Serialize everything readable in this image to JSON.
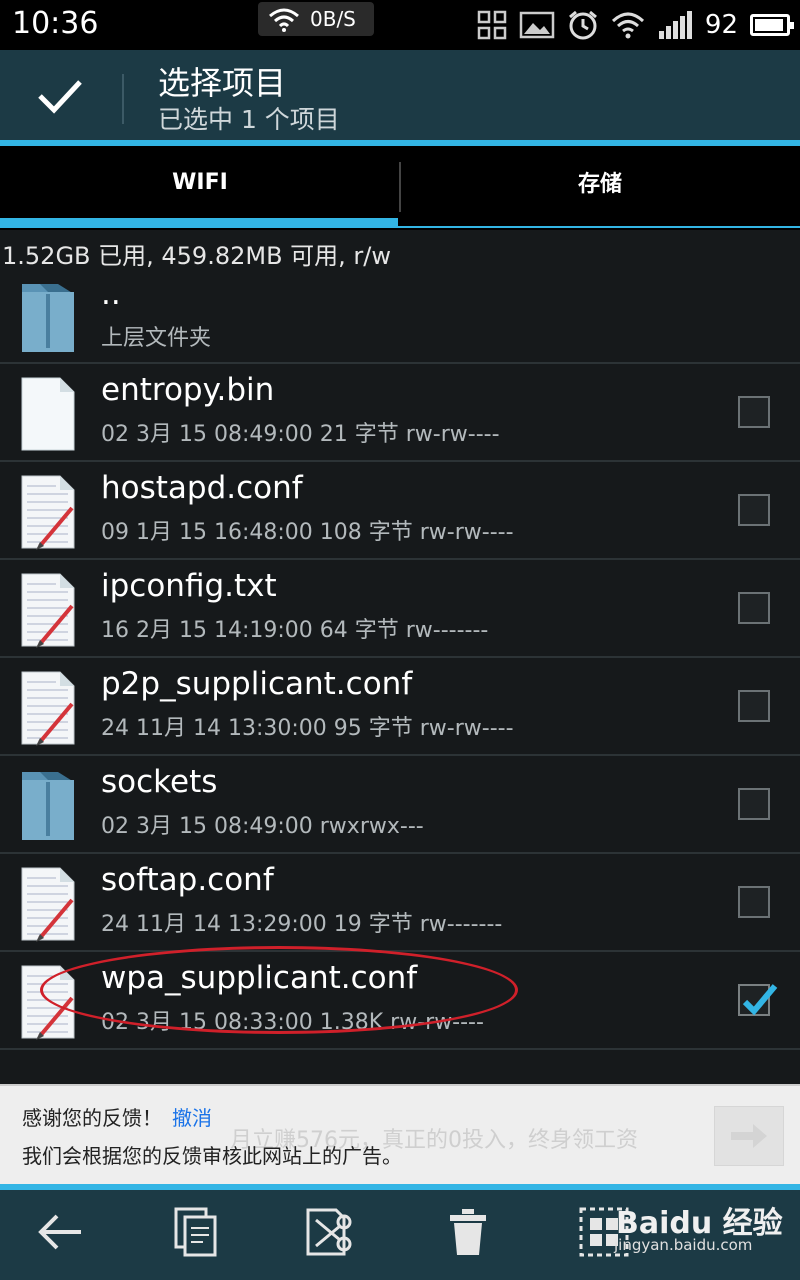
{
  "status_bar": {
    "time": "10:36",
    "net_speed": "0B/S",
    "battery_percent": "92",
    "battery_level": 0.92,
    "icons": [
      "qr-scan-icon",
      "image-icon",
      "alarm-icon",
      "wifi-icon",
      "signal-icon",
      "battery-icon"
    ]
  },
  "action_bar": {
    "title": "选择项目",
    "subtitle": "已选中 1 个项目",
    "confirm_icon": "checkmark-icon"
  },
  "tabs": [
    {
      "label": "WIFI",
      "active": true
    },
    {
      "label": "存储",
      "active": false
    }
  ],
  "storage_info": "1.52GB 已用, 459.82MB 可用, r/w",
  "files": [
    {
      "name": "..",
      "meta": "上层文件夹",
      "type": "folder",
      "checkbox": false
    },
    {
      "name": "entropy.bin",
      "meta": "02 3月 15 08:49:00  21 字节  rw-rw----",
      "type": "blank-file",
      "checkbox": true,
      "checked": false
    },
    {
      "name": "hostapd.conf",
      "meta": "09 1月 15 16:48:00  108 字节  rw-rw----",
      "type": "text-file",
      "checkbox": true,
      "checked": false
    },
    {
      "name": "ipconfig.txt",
      "meta": "16 2月 15 14:19:00  64 字节  rw-------",
      "type": "text-file",
      "checkbox": true,
      "checked": false
    },
    {
      "name": "p2p_supplicant.conf",
      "meta": "24 11月 14 13:30:00  95 字节  rw-rw----",
      "type": "text-file",
      "checkbox": true,
      "checked": false
    },
    {
      "name": "sockets",
      "meta": "02 3月 15 08:49:00     rwxrwx---",
      "type": "folder",
      "checkbox": true,
      "checked": false
    },
    {
      "name": "softap.conf",
      "meta": "24 11月 14 13:29:00  19 字节  rw-------",
      "type": "text-file",
      "checkbox": true,
      "checked": false
    },
    {
      "name": "wpa_supplicant.conf",
      "meta": "02 3月 15 08:33:00  1.38K  rw-rw----",
      "type": "text-file",
      "checkbox": true,
      "checked": true
    }
  ],
  "feedback_banner": {
    "title": "感谢您的反馈！",
    "undo_label": "撤消",
    "message": "我们会根据您的反馈审核此网站上的广告。",
    "background_ad_text": "月立赚576元，真正的0投入，终身领工资"
  },
  "bottom_bar": {
    "buttons": [
      "back-arrow-icon",
      "copy-icon",
      "cut-icon",
      "delete-icon",
      "select-all-icon"
    ]
  },
  "watermark": {
    "logo_text": "Baidu 经验",
    "url": "jingyan.baidu.com"
  },
  "colors": {
    "accent": "#33b5e5",
    "action_bar": "#1c3a45",
    "annotation": "#d0202a"
  }
}
